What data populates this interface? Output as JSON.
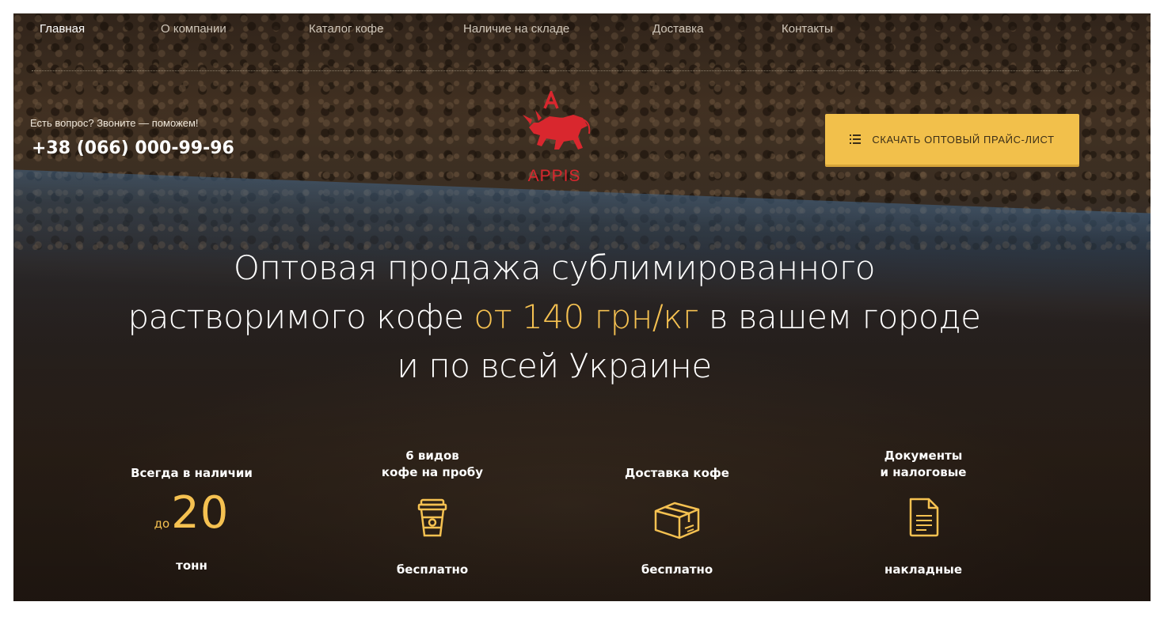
{
  "nav": {
    "items": [
      {
        "label": "Главная",
        "active": true
      },
      {
        "label": "О компании",
        "active": false
      },
      {
        "label": "Каталог кофе",
        "active": false
      },
      {
        "label": "Наличие на складе",
        "active": false
      },
      {
        "label": "Доставка",
        "active": false
      },
      {
        "label": "Контакты",
        "active": false
      }
    ]
  },
  "contact": {
    "question": "Есть вопрос? Звоните — поможем!",
    "phone": "+38 (066) 000-99-96"
  },
  "logo": {
    "text": "APPIS",
    "icon": "bull-logo-icon"
  },
  "price_button": {
    "label": "СКАЧАТЬ ОПТОВЫЙ ПРАЙС-ЛИСТ",
    "icon": "list-icon"
  },
  "headline": {
    "line1": "Оптовая продажа сублимированного",
    "line2_before": "растворимого кофе ",
    "line2_price": "от 140 грн/кг",
    "line2_after": " в вашем городе",
    "line3": "и по всей Украине"
  },
  "features": [
    {
      "title_1": "Всегда в наличии",
      "prefix": "до",
      "number": "20",
      "bottom": "тонн"
    },
    {
      "title_1": "6 видов",
      "title_2": "кофе на пробу",
      "icon": "coffee-cup-icon",
      "bottom": "бесплатно"
    },
    {
      "title_1": "Доставка кофе",
      "icon": "package-box-icon",
      "bottom": "бесплатно"
    },
    {
      "title_1": "Документы",
      "title_2": "и налоговые",
      "icon": "document-icon",
      "bottom": "накладные"
    }
  ],
  "colors": {
    "accent": "#f5c151",
    "button": "#f2c04b",
    "logo": "#d9272e",
    "text": "#ffffff"
  }
}
